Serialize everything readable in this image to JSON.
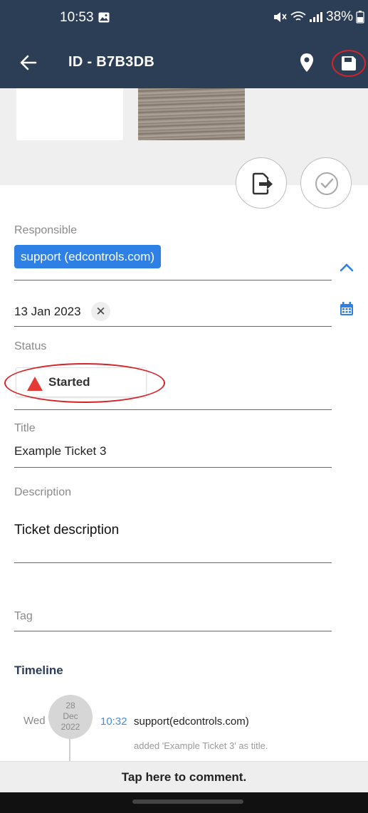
{
  "status_bar": {
    "time": "10:53",
    "battery": "38%"
  },
  "app_bar": {
    "title": "ID - B7B3DB"
  },
  "responsible": {
    "label": "Responsible",
    "value": "support (edcontrols.com)"
  },
  "due_date": {
    "value": "13 Jan 2023",
    "clear_glyph": "✕"
  },
  "status": {
    "label": "Status",
    "value": "Started"
  },
  "title_field": {
    "label": "Title",
    "value": "Example Ticket 3"
  },
  "description": {
    "label": "Description",
    "value": "Ticket description"
  },
  "tag": {
    "label": "Tag"
  },
  "timeline": {
    "heading": "Timeline",
    "entries": [
      {
        "day": "Wed",
        "date_day": "28",
        "date_month": "Dec",
        "date_year": "2022",
        "time": "10:32",
        "user": "support(edcontrols.com)",
        "action": "added 'Example Ticket 3' as title."
      }
    ]
  },
  "comment": {
    "prompt": "Tap here to comment."
  },
  "colors": {
    "app_bar": "#2c3e55",
    "chip_blue": "#2f80e4",
    "annotation_red": "#d5232a",
    "status_red": "#e53935"
  },
  "icons": [
    "back-arrow-icon",
    "location-pin-icon",
    "save-icon",
    "export-icon",
    "check-circle-icon",
    "chevron-up-icon",
    "calendar-icon",
    "status-triangle-icon"
  ]
}
